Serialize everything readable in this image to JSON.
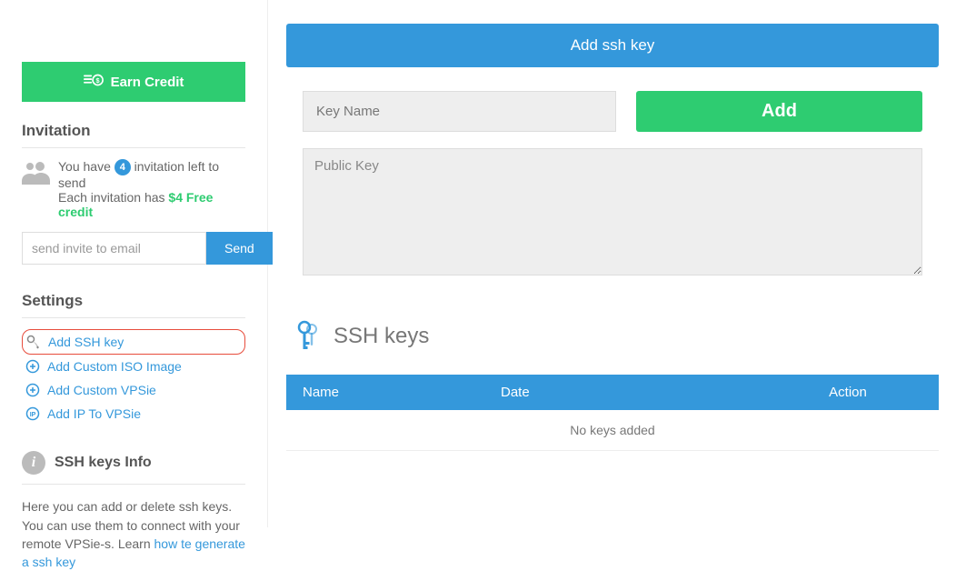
{
  "sidebar": {
    "earn_credit_label": "Earn Credit",
    "invitation_title": "Invitation",
    "invitation_line1_pre": "You have",
    "invitation_count": "4",
    "invitation_line1_post": "invitation left to send",
    "invitation_line2_pre": "Each invitation has",
    "invitation_free_credit": "$4 Free credit",
    "invite_placeholder": "send invite to email",
    "send_label": "Send",
    "settings_title": "Settings",
    "settings_items": {
      "add_ssh": "Add SSH key",
      "add_iso": "Add Custom ISO Image",
      "add_vpsie": "Add Custom VPSie",
      "add_ip": "Add IP To VPSie"
    },
    "info_title": "SSH keys Info",
    "info_text_pre": "Here you can add or delete ssh keys. You can use them to connect with your remote VPSie-s. Learn ",
    "info_link": "how te generate a ssh key"
  },
  "main": {
    "header_label": "Add ssh key",
    "key_name_placeholder": "Key Name",
    "add_button_label": "Add",
    "public_key_placeholder": "Public Key",
    "ssh_keys_title": "SSH keys",
    "table": {
      "col_name": "Name",
      "col_date": "Date",
      "col_action": "Action",
      "empty": "No keys added"
    }
  }
}
